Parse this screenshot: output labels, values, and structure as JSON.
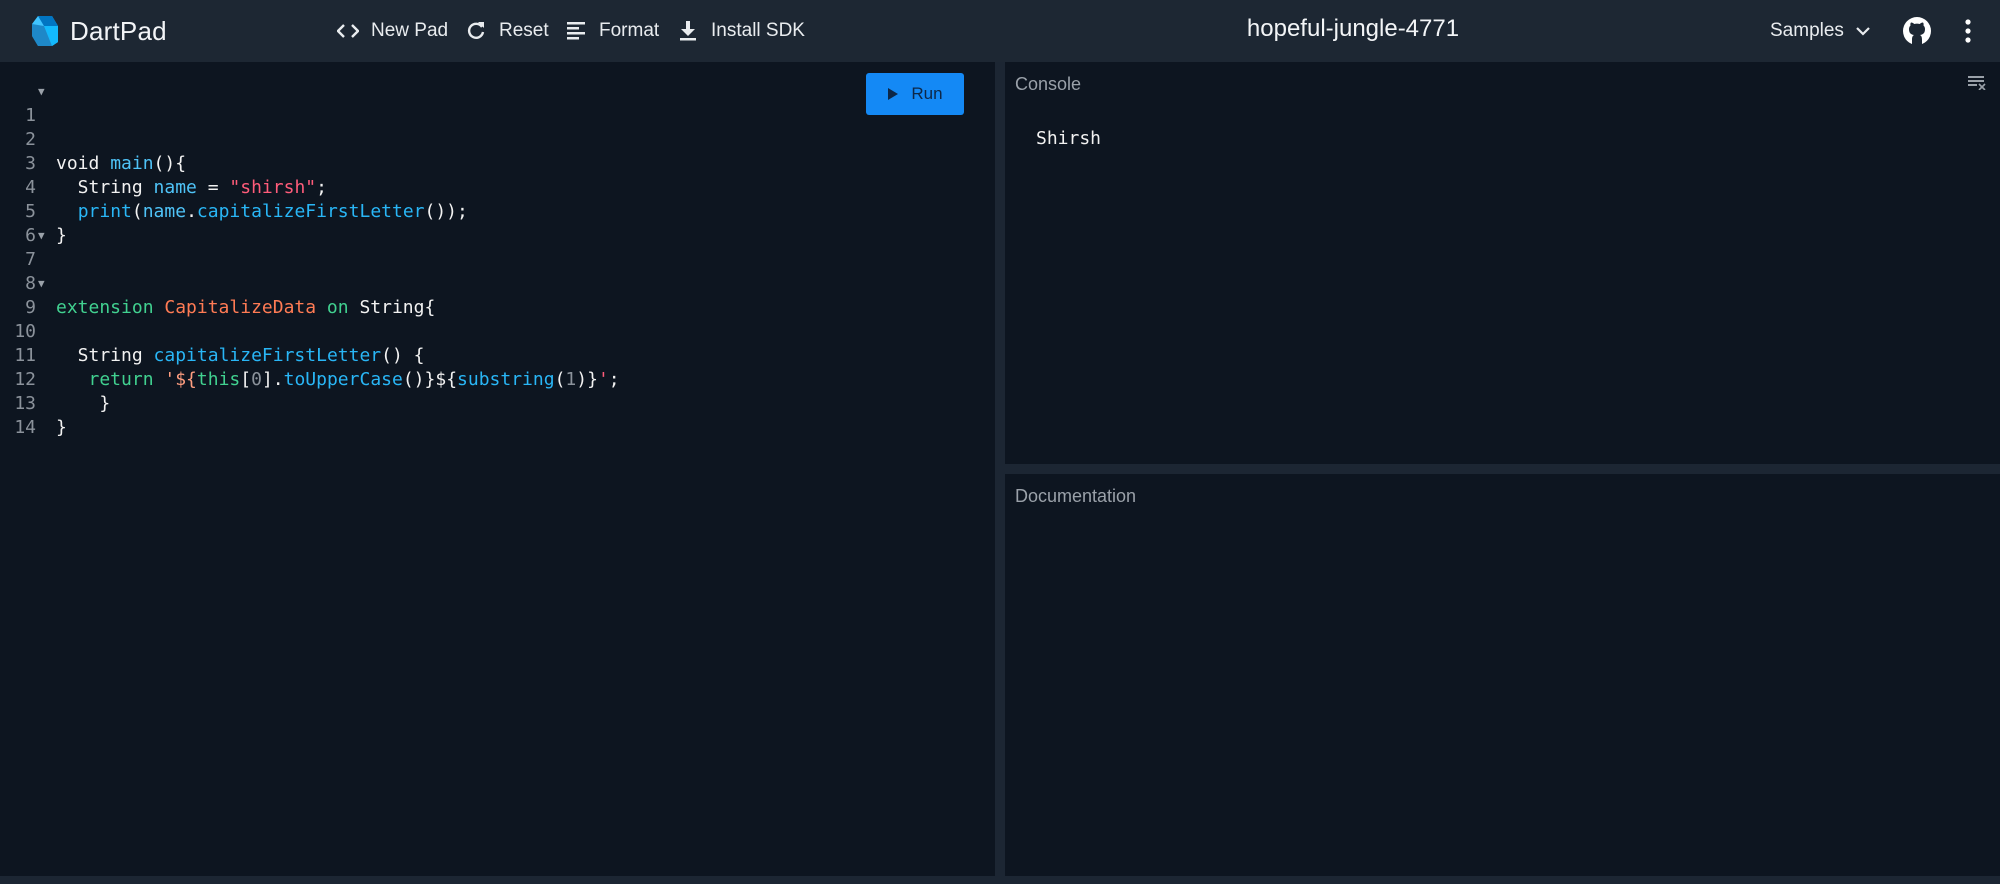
{
  "header": {
    "brand": "DartPad",
    "buttons": {
      "new_pad": "New Pad",
      "reset": "Reset",
      "format": "Format",
      "install_sdk": "Install SDK"
    },
    "pad_name": "hopeful-jungle-4771",
    "samples_label": "Samples"
  },
  "editor": {
    "run_label": "Run",
    "lines": [
      {
        "n": "1",
        "fold": "▼"
      },
      {
        "n": "2",
        "fold": ""
      },
      {
        "n": "3",
        "fold": ""
      },
      {
        "n": "4",
        "fold": ""
      },
      {
        "n": "5",
        "fold": ""
      },
      {
        "n": "6",
        "fold": ""
      },
      {
        "n": "7",
        "fold": "▼"
      },
      {
        "n": "8",
        "fold": ""
      },
      {
        "n": "9",
        "fold": "▼"
      },
      {
        "n": "10",
        "fold": ""
      },
      {
        "n": "11",
        "fold": ""
      },
      {
        "n": "12",
        "fold": ""
      },
      {
        "n": "13",
        "fold": ""
      },
      {
        "n": "14",
        "fold": ""
      }
    ],
    "tokens": {
      "l1": [
        "void ",
        "main",
        "(){"
      ],
      "l2": [
        "  String ",
        "name",
        " = ",
        "\"shirsh\"",
        ";"
      ],
      "l3": [
        "  ",
        "print",
        "(",
        "name",
        ".",
        "capitalizeFirstLetter",
        "());"
      ],
      "l4": [
        "}"
      ],
      "l7": [
        "extension ",
        "CapitalizeData",
        " on ",
        "String{"
      ],
      "l9": [
        "  String ",
        "capitalizeFirstLetter",
        "() {"
      ],
      "l10": [
        "   return ",
        "'${",
        "this",
        "[",
        "0",
        "].",
        "toUpperCase",
        "()}${",
        "substring",
        "(",
        "1",
        ")}",
        "'",
        ";"
      ],
      "l11": [
        "    }"
      ],
      "l12": [
        "}"
      ]
    }
  },
  "console": {
    "label": "Console",
    "output": "Shirsh"
  },
  "documentation": {
    "label": "Documentation"
  },
  "colors": {
    "header_bg": "#1d2733",
    "editor_bg": "#0d1520",
    "run_button": "#1489f5",
    "string": "#ff5c7a",
    "keyword": "#41d190",
    "class": "#ff7b54",
    "function": "#29b6f6"
  }
}
